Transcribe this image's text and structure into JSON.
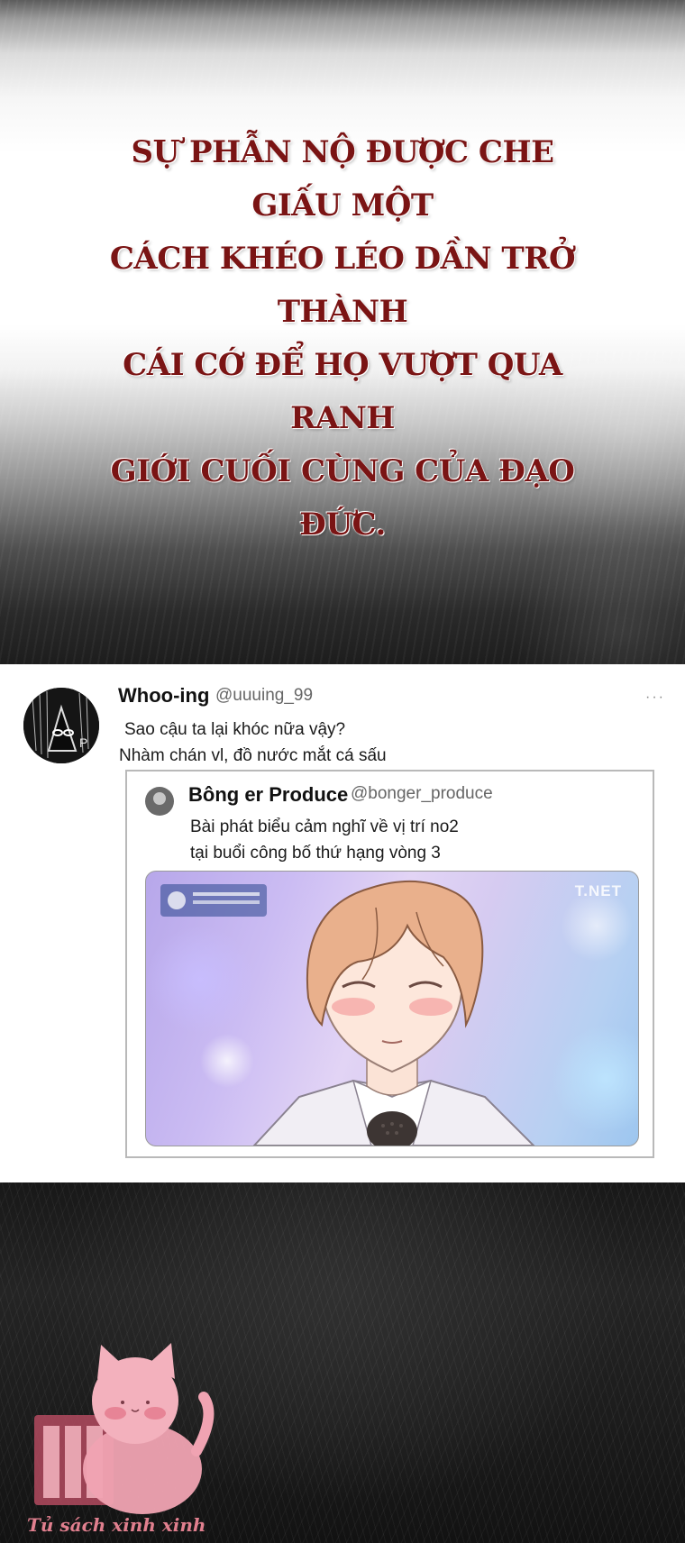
{
  "narration": {
    "lines": [
      "SỰ PHẪN NỘ ĐƯỢC CHE GIẤU MỘT",
      "CÁCH KHÉO LÉO DẦN TRỞ THÀNH",
      "CÁI CỚ ĐỂ HỌ VƯỢT QUA RANH",
      "GIỚI CUỐI CÙNG CỦA ĐẠO ĐỨC."
    ],
    "color": "#7a1414"
  },
  "tweet": {
    "author_name": "Whoo-ing",
    "author_handle": "@uuuing_99",
    "more_icon": "more-dots-icon",
    "more_glyph": "···",
    "text_lines": [
      "Sao cậu ta lại khóc nữa vậy?",
      "Nhàm chán vl, đồ nước mắt cá sấu"
    ],
    "quote": {
      "author_name": "Bông er Produce",
      "author_handle": "@bonger_produce",
      "text_lines": [
        "Bài phát biểu cảm nghĩ về vị trí no2",
        "tại buổi công bố thứ hạng vòng 3"
      ],
      "image": {
        "description_icon": "broadcast-screenshot",
        "broadcast_logo": "T.NET"
      }
    }
  },
  "watermark": {
    "text": "Tủ sách xinh xinh",
    "icon": "cat-bookshelf-logo",
    "color": "#e07f8e"
  }
}
